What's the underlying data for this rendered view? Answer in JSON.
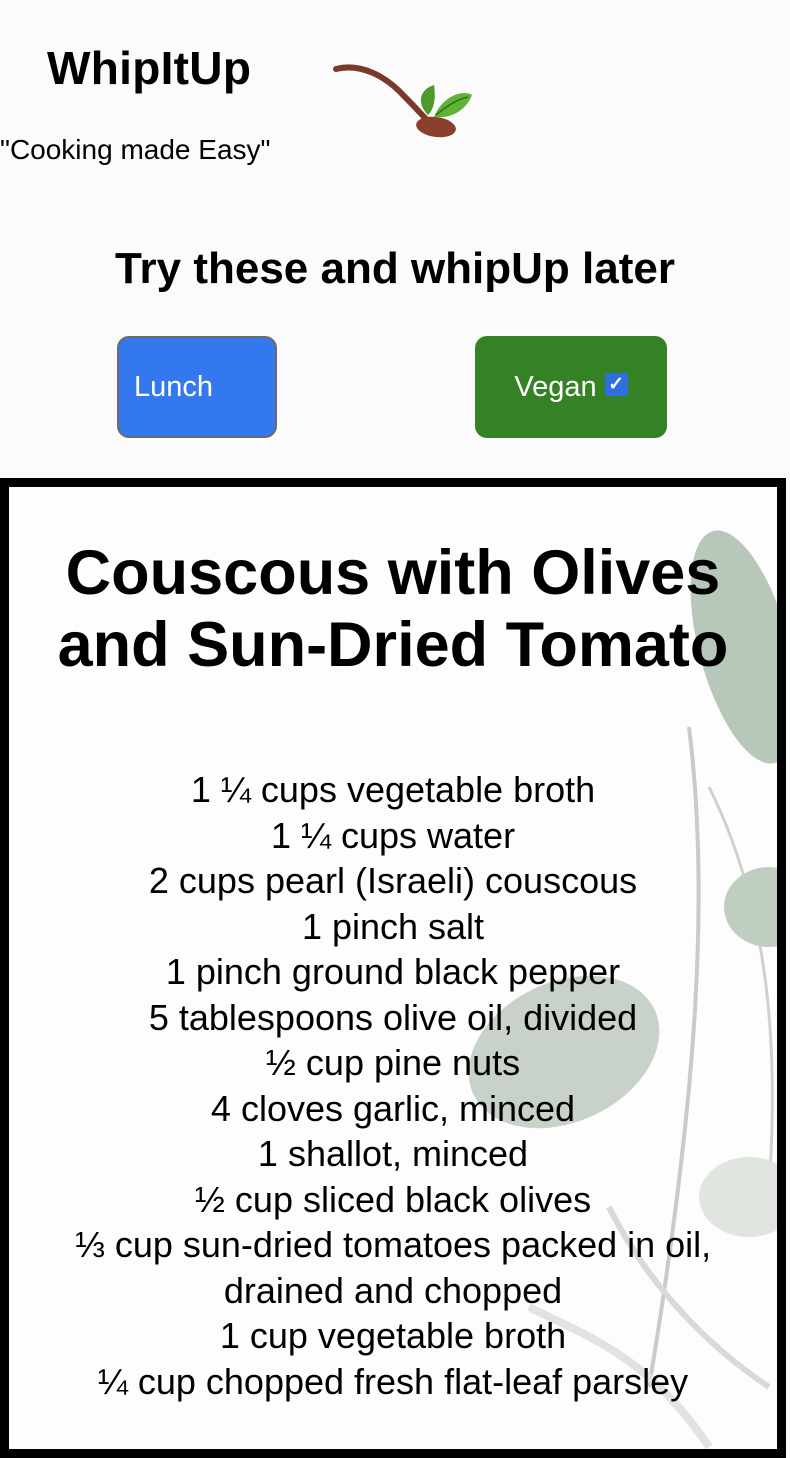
{
  "header": {
    "brand": "WhipItUp",
    "tagline": "\"Cooking made Easy\"",
    "logo_icon": "spoon-leaf-icon"
  },
  "section": {
    "heading": "Try these and whipUp later"
  },
  "filters": {
    "lunch_label": "Lunch",
    "vegan_label": "Vegan",
    "vegan_checked": "✓"
  },
  "colors": {
    "lunch_button": "#3478f0",
    "vegan_button": "#358226",
    "card_border": "#000000"
  },
  "recipe": {
    "title": "Couscous with Olives and Sun-Dried Tomato",
    "ingredients": [
      "1 ¼ cups vegetable broth",
      "1 ¼ cups water",
      "2 cups pearl (Israeli) couscous",
      "1 pinch salt",
      "1 pinch ground black pepper",
      "5 tablespoons olive oil, divided",
      "½ cup pine nuts",
      "4 cloves garlic, minced",
      "1 shallot, minced",
      "½ cup sliced black olives",
      "⅓ cup sun-dried tomatoes packed in oil, drained and chopped",
      "1 cup vegetable broth",
      "¼ cup chopped fresh flat-leaf parsley"
    ]
  }
}
